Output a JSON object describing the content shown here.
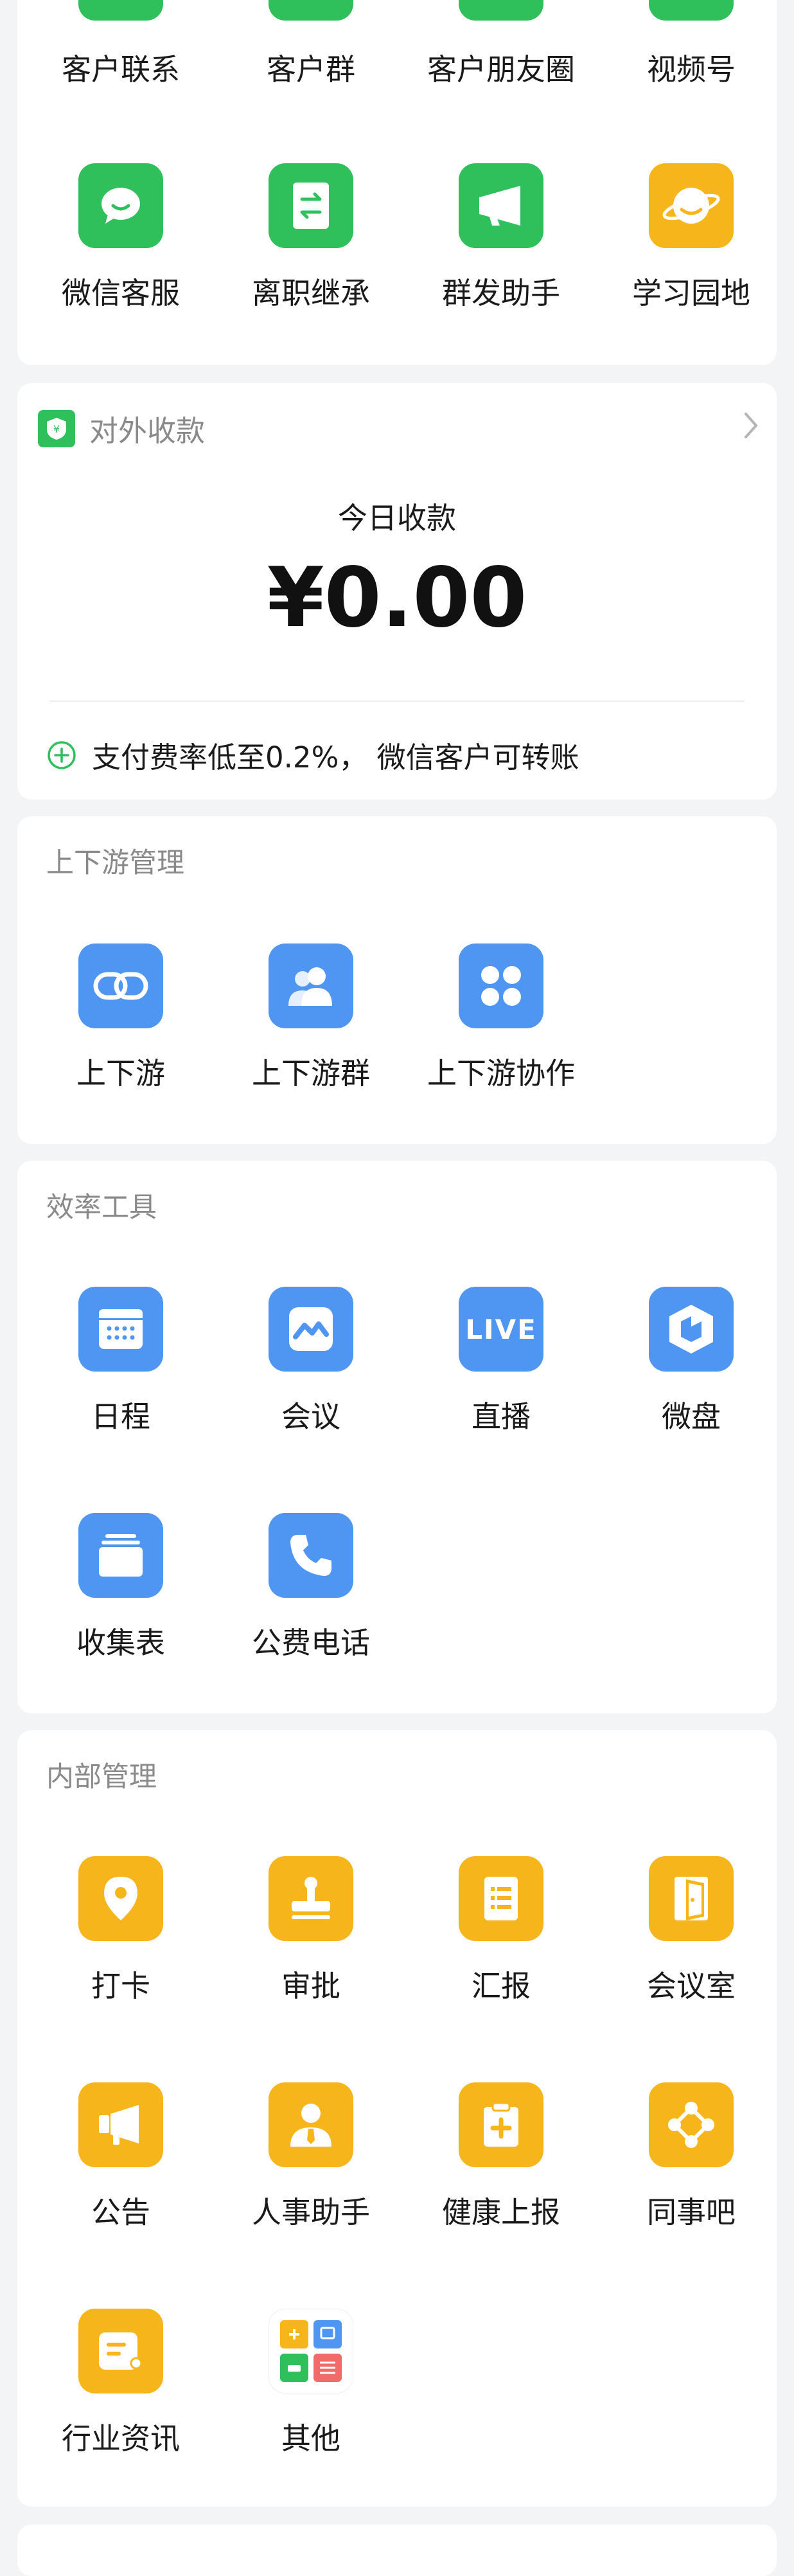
{
  "customer": {
    "top_row": [
      "客户联系",
      "客户群",
      "客户朋友圈",
      "视频号"
    ],
    "second_row": [
      {
        "label": "微信客服",
        "icon": "chat-bubble-icon"
      },
      {
        "label": "离职继承",
        "icon": "transfer-doc-icon"
      },
      {
        "label": "群发助手",
        "icon": "megaphone-icon"
      },
      {
        "label": "学习园地",
        "icon": "planet-icon"
      }
    ]
  },
  "payment": {
    "header": "对外收款",
    "today_label": "今日收款",
    "amount": "¥0.00",
    "tip": "支付费率低至0.2%， 微信客户可转账"
  },
  "supply_chain": {
    "title": "上下游管理",
    "apps": [
      {
        "label": "上下游",
        "icon": "link-icon"
      },
      {
        "label": "上下游群",
        "icon": "group-icon"
      },
      {
        "label": "上下游协作",
        "icon": "four-dots-icon"
      }
    ]
  },
  "efficiency": {
    "title": "效率工具",
    "apps": [
      {
        "label": "日程",
        "icon": "calendar-icon"
      },
      {
        "label": "会议",
        "icon": "meeting-icon"
      },
      {
        "label": "直播",
        "icon": "live-icon",
        "text": "LIVE"
      },
      {
        "label": "微盘",
        "icon": "cube-icon"
      },
      {
        "label": "收集表",
        "icon": "form-stack-icon"
      },
      {
        "label": "公费电话",
        "icon": "phone-icon"
      }
    ]
  },
  "internal": {
    "title": "内部管理",
    "apps": [
      {
        "label": "打卡",
        "icon": "location-pin-icon"
      },
      {
        "label": "审批",
        "icon": "stamp-icon"
      },
      {
        "label": "汇报",
        "icon": "report-icon"
      },
      {
        "label": "会议室",
        "icon": "door-icon"
      },
      {
        "label": "公告",
        "icon": "announcement-icon"
      },
      {
        "label": "人事助手",
        "icon": "person-tie-icon"
      },
      {
        "label": "健康上报",
        "icon": "health-clipboard-icon"
      },
      {
        "label": "同事吧",
        "icon": "network-icon"
      },
      {
        "label": "行业资讯",
        "icon": "news-icon"
      },
      {
        "label": "其他",
        "icon": "app-grid-icon"
      }
    ]
  }
}
